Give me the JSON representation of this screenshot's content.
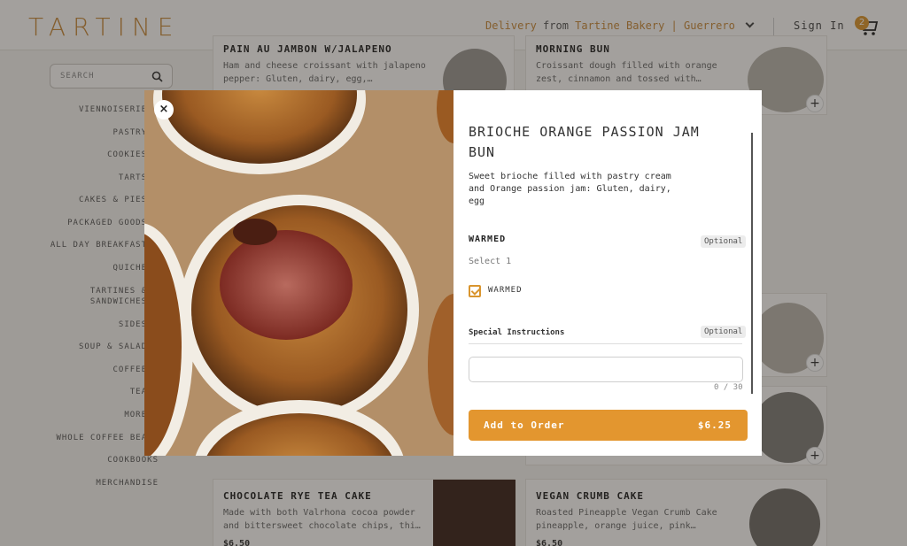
{
  "header": {
    "logo": "TARTINE",
    "delivery_label": "Delivery",
    "from_label": "from",
    "location": "Tartine Bakery | Guerrero",
    "signin": "Sign In",
    "cart_count": "2"
  },
  "sidebar": {
    "search_placeholder": "SEARCH",
    "categories": [
      "VIENNOISERIE",
      "PASTRY",
      "COOKIES",
      "TARTS",
      "CAKES & PIES",
      "PACKAGED GOODS",
      "ALL DAY BREAKFAST",
      "QUICHE",
      "TARTINES &",
      "SANDWICHES",
      "SIDES",
      "SOUP & SALAD",
      "COFFEE",
      "TEA",
      "MORE",
      "WHOLE COFFEE BEANS",
      "COOKBOOKS",
      "MERCHANDISE"
    ]
  },
  "products": [
    {
      "title": "PAIN AU JAMBON W/JALAPENO",
      "desc": "Ham and cheese croissant with jalapeno pepper: Gluten, dairy, egg,…",
      "price": ""
    },
    {
      "title": "MORNING BUN",
      "desc": "Croissant dough filled with orange zest, cinnamon and tossed with…",
      "price": ""
    },
    {
      "title": "CHOCOLATE RYE TEA CAKE",
      "desc": "Made with both Valrhona cocoa powder and bittersweet chocolate chips, thi…",
      "price": "$6.50"
    },
    {
      "title": "VEGAN CRUMB CAKE",
      "desc": "Roasted Pineapple Vegan Crumb Cake pineapple, orange juice, pink…",
      "price": "$6.50"
    }
  ],
  "modal": {
    "close": "×",
    "title": "BRIOCHE ORANGE PASSION JAM BUN",
    "description": "Sweet brioche filled with pastry cream and Orange passion jam: Gluten, dairy, egg",
    "option_group": {
      "name": "WARMED",
      "badge": "Optional",
      "hint": "Select 1",
      "choice": "WARMED",
      "checked": true
    },
    "special_instructions": {
      "label": "Special Instructions",
      "badge": "Optional",
      "value": "",
      "counter": "0 / 30"
    },
    "add_button": {
      "label": "Add to Order",
      "price": "$6.25"
    }
  },
  "colors": {
    "accent": "#d9952e",
    "logo": "#c7893a"
  }
}
